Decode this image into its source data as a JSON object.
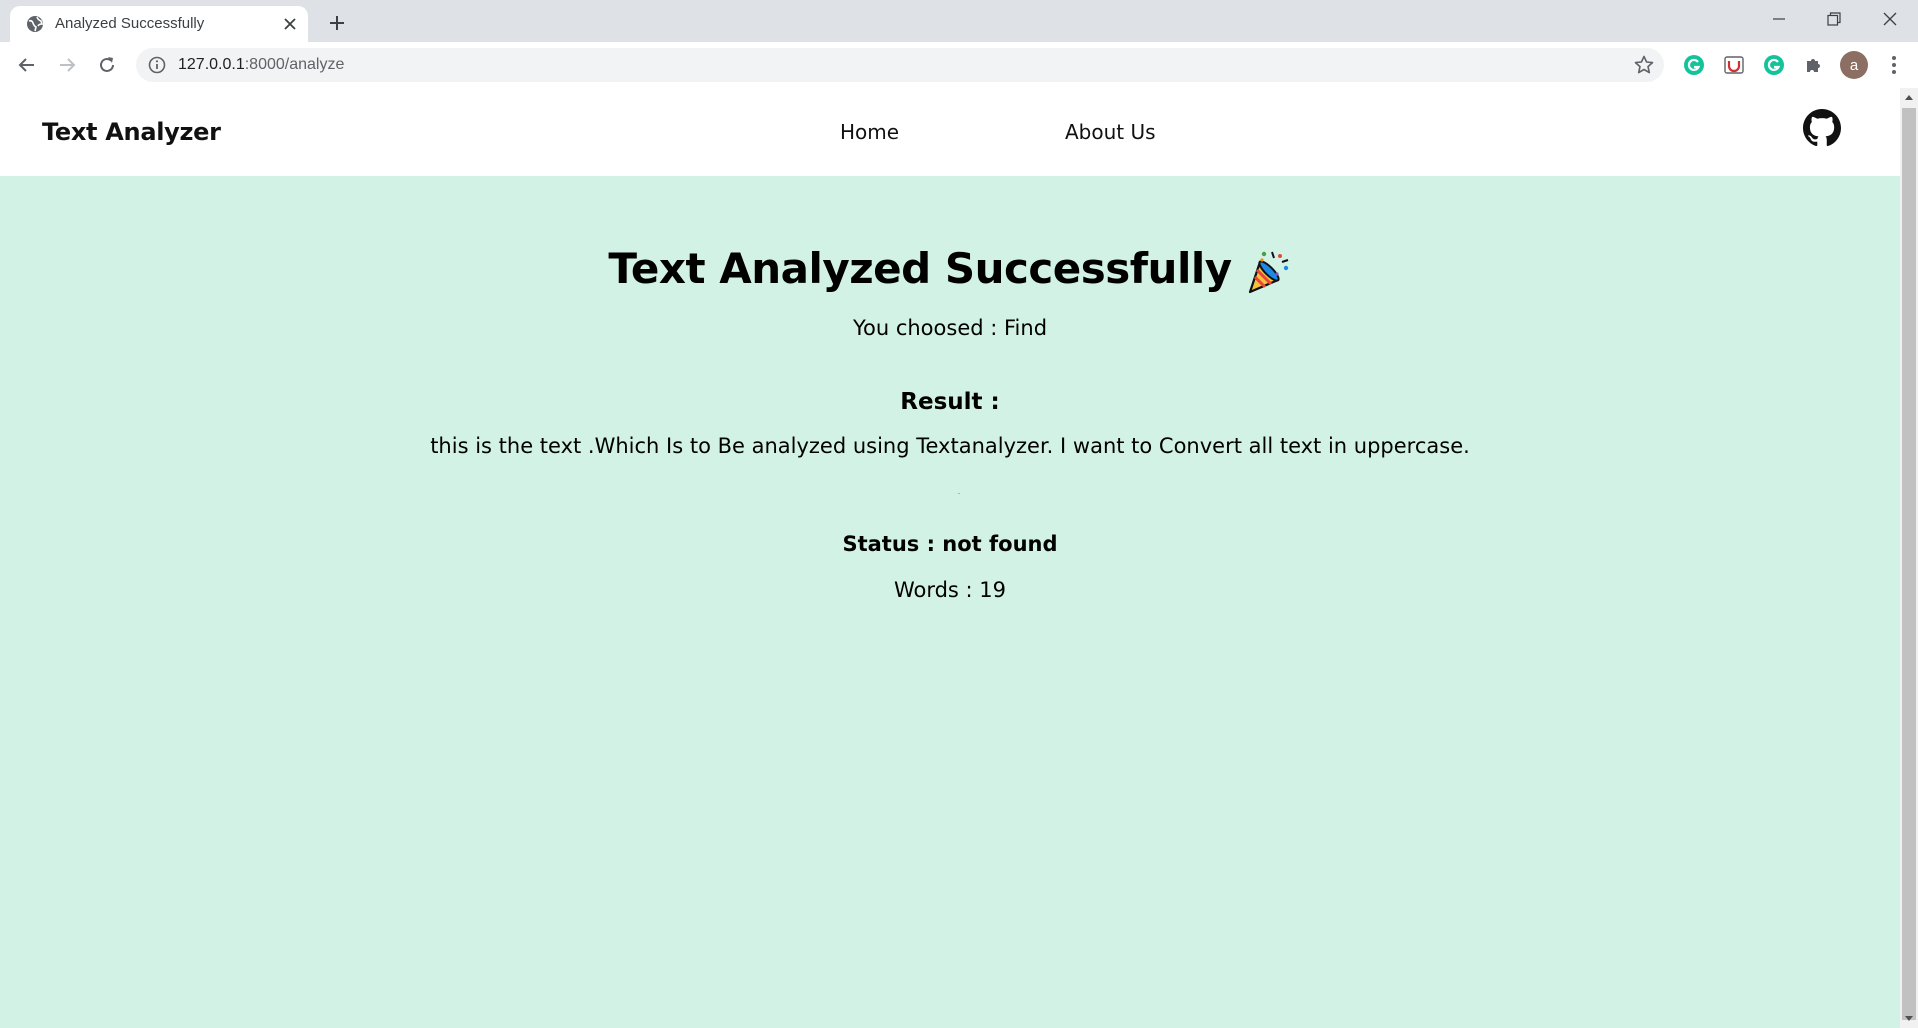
{
  "browser": {
    "tab_title": "Analyzed Successfully",
    "url_host": "127.0.0.1",
    "url_path": ":8000/analyze",
    "profile_initial": "a",
    "extensions": [
      "grammarly-icon",
      "pdf-extension-icon",
      "grammarly-go-icon",
      "puzzle-icon"
    ]
  },
  "navbar": {
    "brand": "Text Analyzer",
    "links": [
      "Home",
      "About Us"
    ],
    "github_icon": "github-icon"
  },
  "main": {
    "heading": "Text Analyzed Successfully",
    "heading_emoji": "party-popper-icon",
    "choice": "You choosed : Find",
    "result_label": "Result :",
    "result_text": "this is the text .Which Is to Be analyzed using Textanalyzer. I want to Convert all text in uppercase.",
    "status": "Status : not found",
    "words": "Words : 19"
  },
  "colors": {
    "page_bg": "#d3f2e6",
    "navbar_bg": "#ffffff",
    "text": "#111111"
  }
}
